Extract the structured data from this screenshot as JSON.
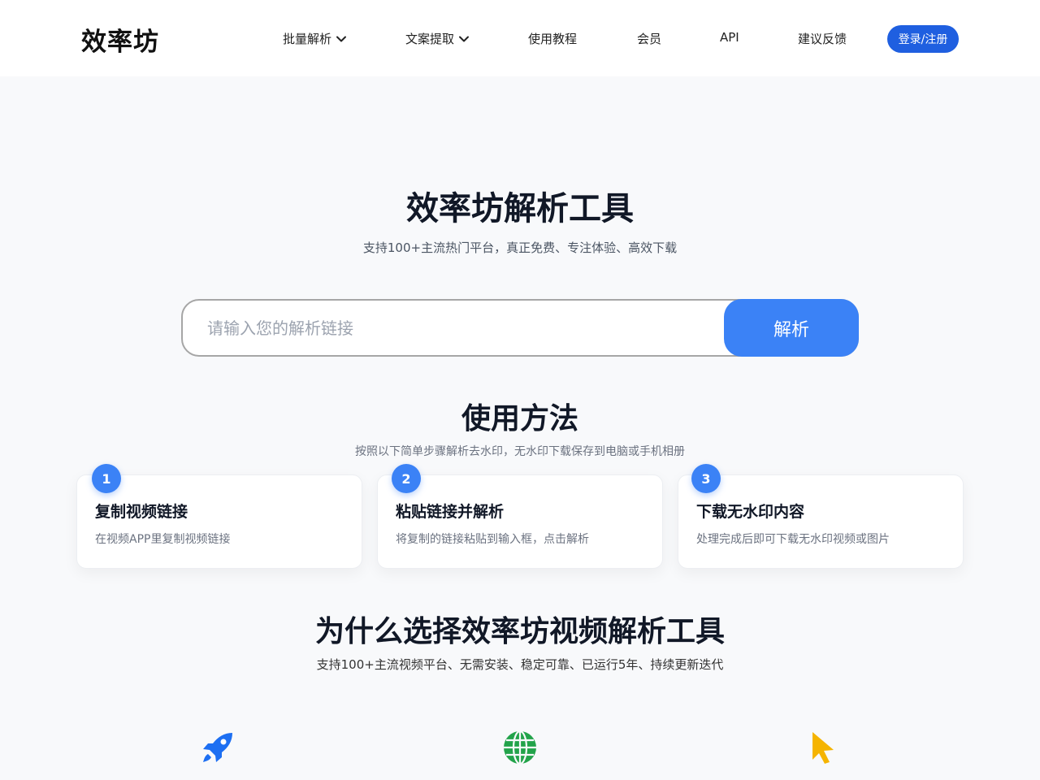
{
  "header": {
    "logo": "效率坊",
    "nav": [
      {
        "label": "批量解析",
        "dropdown": true
      },
      {
        "label": "文案提取",
        "dropdown": true
      },
      {
        "label": "使用教程",
        "dropdown": false
      },
      {
        "label": "会员",
        "dropdown": false
      },
      {
        "label": "API",
        "dropdown": false
      },
      {
        "label": "建议反馈",
        "dropdown": false
      }
    ],
    "login_label": "登录/注册"
  },
  "hero": {
    "title": "效率坊解析工具",
    "subtitle": "支持100+主流热门平台，真正免费、专注体验、高效下载",
    "input_placeholder": "请输入您的解析链接",
    "input_value": "",
    "parse_label": "解析"
  },
  "usage": {
    "title": "使用方法",
    "subtitle": "按照以下简单步骤解析去水印，无水印下载保存到电脑或手机相册",
    "steps": [
      {
        "num": "1",
        "title": "复制视频链接",
        "desc": "在视频APP里复制视频链接"
      },
      {
        "num": "2",
        "title": "粘贴链接并解析",
        "desc": "将复制的链接粘贴到输入框，点击解析"
      },
      {
        "num": "3",
        "title": "下载无水印内容",
        "desc": "处理完成后即可下载无水印视频或图片"
      }
    ]
  },
  "why": {
    "title": "为什么选择效率坊视频解析工具",
    "subtitle": "支持100+主流视频平台、无需安装、稳定可靠、已运行5年、持续更新迭代",
    "features": [
      {
        "icon": "rocket-icon",
        "color": "#1d6ff2"
      },
      {
        "icon": "globe-icon",
        "color": "#22a34a"
      },
      {
        "icon": "pointer-icon",
        "color": "#f5b400"
      }
    ]
  },
  "colors": {
    "accent": "#3b82f6",
    "login": "#1f5fe0"
  }
}
